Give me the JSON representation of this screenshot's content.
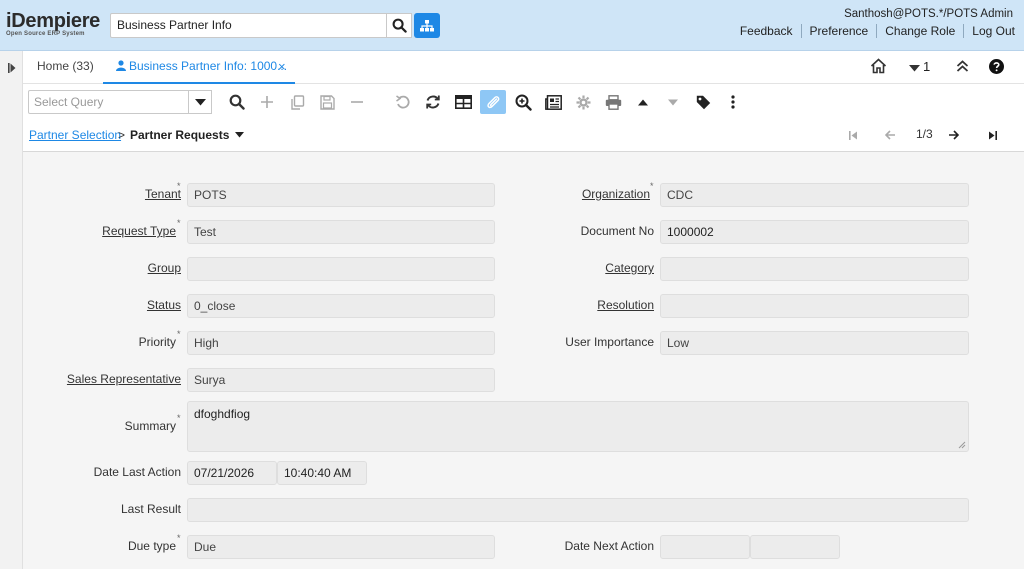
{
  "header": {
    "logo_main": "iDempiere",
    "logo_sub": "Open Source ERP System",
    "search_value": "Business Partner Info",
    "user": "Santhosh@POTS.*/POTS Admin",
    "links": [
      "Feedback",
      "Preference",
      "Change Role",
      "Log Out"
    ]
  },
  "tabs": {
    "home": "Home (33)",
    "active": "Business Partner Info: 1000...",
    "close": "×",
    "window_count": "1"
  },
  "toolbar": {
    "query_placeholder": "Select Query"
  },
  "breadcrumb": {
    "link": "Partner Selection",
    "sep": ">",
    "current": "Partner Requests",
    "record_pos": "1/3"
  },
  "form": {
    "tenant_label": "Tenant",
    "tenant_value": "POTS",
    "org_label": "Organization",
    "org_value": "CDC",
    "reqtype_label": "Request Type",
    "reqtype_value": "Test",
    "docno_label": "Document No",
    "docno_value": "1000002",
    "group_label": "Group",
    "group_value": "",
    "category_label": "Category",
    "category_value": "",
    "status_label": "Status",
    "status_value": "0_close",
    "resolution_label": "Resolution",
    "resolution_value": "",
    "priority_label": "Priority",
    "priority_value": "High",
    "userimp_label": "User Importance",
    "userimp_value": "Low",
    "salesrep_label": "Sales Representative",
    "salesrep_value": "Surya",
    "summary_label": "Summary",
    "summary_value": "dfoghdfiog",
    "datelast_label": "Date Last Action",
    "datelast_date": "07/21/2026",
    "datelast_time": "10:40:40 AM",
    "lastresult_label": "Last Result",
    "lastresult_value": "",
    "duetype_label": "Due type",
    "duetype_value": "Due",
    "datenext_label": "Date Next Action",
    "datenext_date": "",
    "datenext_time": ""
  },
  "colors": {
    "header_bg": "#cfe5f7",
    "accent": "#1e88e5",
    "form_bg": "#f5f5f5",
    "field_bg": "#ececec"
  }
}
